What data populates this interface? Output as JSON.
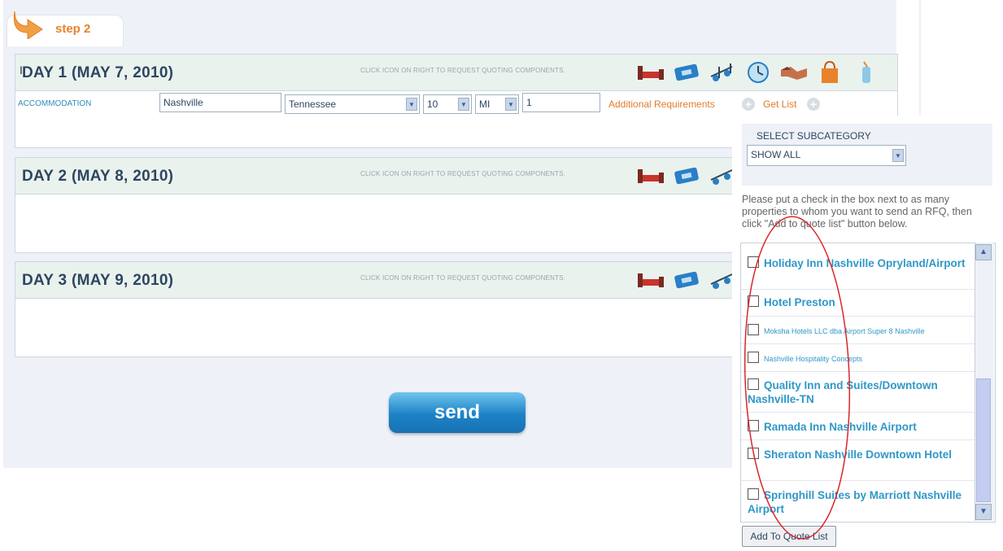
{
  "step": {
    "label": "step 2"
  },
  "days": [
    {
      "title": "DAY 1 (MAY 7, 2010)",
      "hint": "CLICK ICON ON RIGHT TO REQUEST QUOTING COMPONENTS."
    },
    {
      "title": "DAY 2 (MAY 8, 2010)",
      "hint": "CLICK ICON ON RIGHT TO REQUEST QUOTING COMPONENTS."
    },
    {
      "title": "DAY 3 (MAY 9, 2010)",
      "hint": "CLICK ICON ON RIGHT TO REQUEST QUOTING COMPONENTS."
    }
  ],
  "accommodation": {
    "label": "ACCOMMODATION",
    "city": "Nashville",
    "state": "Tennessee",
    "distance": "10",
    "unit": "MI",
    "quantity": "1",
    "additional_requirements": "Additional Requirements",
    "get_list": "Get List"
  },
  "send": {
    "label": "send"
  },
  "subcategory": {
    "label": "SELECT SUBCATEGORY",
    "selected": "SHOW ALL"
  },
  "instructions": "Please put a check in the box next to as many properties to whom you want to send an RFQ, then click \"Add to quote list\" button below.",
  "properties": [
    {
      "name": "Holiday Inn Nashville Opryland/Airport",
      "small": false
    },
    {
      "name": "Hotel Preston",
      "small": false
    },
    {
      "name": "Moksha Hotels LLC dba Airport Super 8 Nashville",
      "small": true
    },
    {
      "name": "Nashville Hospitality Concepts",
      "small": true
    },
    {
      "name": "Quality Inn and Suites/Downtown Nashville-TN",
      "small": false
    },
    {
      "name": "Ramada Inn Nashville Airport",
      "small": false
    },
    {
      "name": "Sheraton Nashville Downtown Hotel",
      "small": false
    },
    {
      "name": "Springhill Suites by Marriott Nashville Airport",
      "small": false
    }
  ],
  "add_to_quote": {
    "label": "Add To Quote List"
  },
  "colors": {
    "accent_orange": "#e8822a",
    "link_blue": "#2f98c7",
    "heading": "#2d4660",
    "annotation_red": "#d9262b"
  }
}
